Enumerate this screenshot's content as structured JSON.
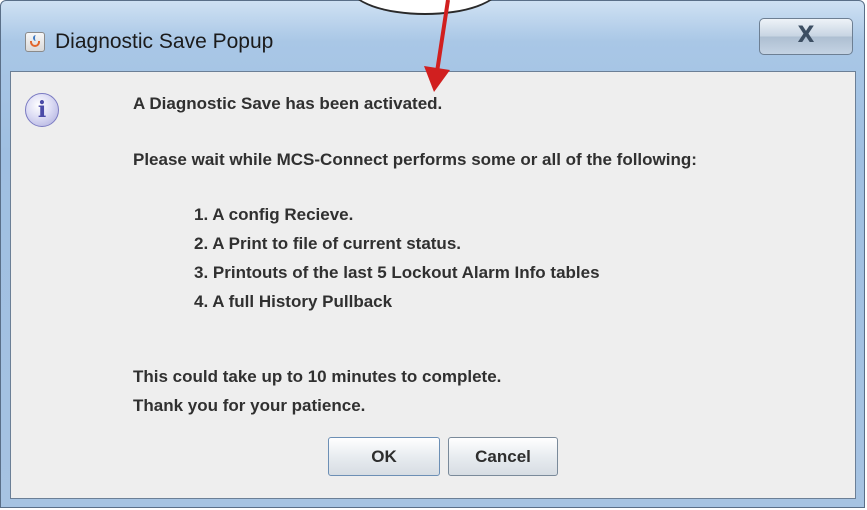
{
  "window": {
    "title": "Diagnostic Save Popup",
    "close_label": "X"
  },
  "dialog": {
    "icon": "info-icon",
    "line1": "A Diagnostic Save has been activated.",
    "line2": "Please wait while MCS-Connect performs some or all of the following:",
    "items": [
      "1. A config Recieve.",
      "2. A Print to file of current status.",
      "3. Printouts of the last 5 Lockout Alarm Info tables",
      "4. A full History Pullback"
    ],
    "footer1": "This could take up to 10 minutes to complete.",
    "footer2": "Thank you for your patience."
  },
  "buttons": {
    "ok": "OK",
    "cancel": "Cancel"
  },
  "colors": {
    "annotation_arrow": "#d11f1f",
    "dialog_background": "#eeeeee"
  }
}
